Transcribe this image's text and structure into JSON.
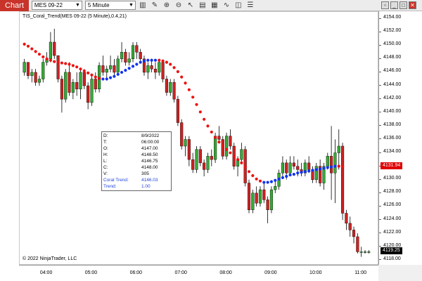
{
  "toolbar": {
    "chart_tab": "Chart",
    "instrument": "MES 09-22",
    "interval": "5 Minute",
    "icons": [
      "bars-type-icon",
      "draw-tool-icon",
      "zoom-in-icon",
      "zoom-out-icon",
      "pointer-icon",
      "data-box-icon",
      "properties-icon",
      "indicators-icon",
      "strategies-icon",
      "templates-icon"
    ],
    "window_buttons": [
      "restore",
      "minimize",
      "maximize",
      "close"
    ]
  },
  "chart_title": "TIS_Coral_Trend(MES 09-22 (5 Minute),0.4,21)",
  "copyright": "© 2022 NinjaTrader, LLC",
  "info_box": {
    "rows": [
      {
        "label": "D:",
        "value": "8/9/2022"
      },
      {
        "label": "T:",
        "value": "06:00:00"
      },
      {
        "label": "O:",
        "value": "4147.00"
      },
      {
        "label": "H:",
        "value": "4148.50"
      },
      {
        "label": "L:",
        "value": "4146.75"
      },
      {
        "label": "C:",
        "value": "4148.00"
      },
      {
        "label": "V:",
        "value": "305"
      },
      {
        "label": "Coral Trend:",
        "value": "4146.03"
      },
      {
        "label": "Trend:",
        "value": "1.00"
      }
    ]
  },
  "price_labels": {
    "coral": {
      "text": "4131.94",
      "value": 4131.94,
      "color": "#e00000"
    },
    "last": {
      "text": "4119.25",
      "value": 4119.25,
      "color": "#000000"
    }
  },
  "colors": {
    "up": "#33aa33",
    "down": "#cc2222",
    "coral_up": "#1133ee",
    "coral_down": "#ee1111"
  },
  "chart_data": {
    "type": "candlestick",
    "title": "TIS_Coral_Trend(MES 09-22 (5 Minute),0.4,21)",
    "y_ticks": [
      4118,
      4120,
      4122,
      4124,
      4126,
      4128,
      4130,
      4132,
      4134,
      4136,
      4138,
      4140,
      4142,
      4144,
      4146,
      4148,
      4150,
      4152,
      4154
    ],
    "y_tick_labels": [
      "4118.00",
      "4120.00",
      "4122.00",
      "4124.00",
      "4126.00",
      "4128.00",
      "4130.00",
      "4132.00",
      "4134.00",
      "4136.00",
      "4138.00",
      "4140.00",
      "4142.00",
      "4144.00",
      "4146.00",
      "4148.00",
      "4150.00",
      "4152.00",
      "4154.00"
    ],
    "ylim": [
      4117.2,
      4155.0
    ],
    "x_labels": [
      "04:00",
      "05:00",
      "06:00",
      "07:00",
      "08:00",
      "09:00",
      "10:00",
      "11:00"
    ],
    "x_label_bar_index": [
      6,
      18,
      30,
      42,
      54,
      66,
      78,
      90
    ],
    "bar_count": 93,
    "candles": [
      [
        4146.0,
        4148.0,
        4145.5,
        4147.5
      ],
      [
        4147.5,
        4147.5,
        4145.0,
        4145.5
      ],
      [
        4145.5,
        4146.5,
        4144.5,
        4146.0
      ],
      [
        4146.0,
        4146.5,
        4144.0,
        4144.5
      ],
      [
        4144.5,
        4145.5,
        4144.0,
        4145.0
      ],
      [
        4145.0,
        4148.0,
        4144.5,
        4147.5
      ],
      [
        4147.5,
        4149.0,
        4147.0,
        4148.0
      ],
      [
        4148.0,
        4152.0,
        4147.5,
        4150.5
      ],
      [
        4150.5,
        4152.5,
        4148.0,
        4148.5
      ],
      [
        4148.5,
        4148.5,
        4144.5,
        4145.0
      ],
      [
        4145.0,
        4145.5,
        4140.0,
        4142.0
      ],
      [
        4142.0,
        4146.5,
        4141.5,
        4146.0
      ],
      [
        4146.0,
        4147.5,
        4142.5,
        4143.0
      ],
      [
        4143.0,
        4145.0,
        4142.0,
        4144.5
      ],
      [
        4144.5,
        4146.0,
        4142.5,
        4143.5
      ],
      [
        4143.5,
        4146.5,
        4142.0,
        4146.0
      ],
      [
        4146.0,
        4146.5,
        4143.5,
        4144.0
      ],
      [
        4144.0,
        4144.5,
        4140.5,
        4141.5
      ],
      [
        4141.5,
        4145.5,
        4141.0,
        4145.0
      ],
      [
        4145.0,
        4146.0,
        4143.0,
        4143.5
      ],
      [
        4143.5,
        4147.5,
        4143.0,
        4147.0
      ],
      [
        4147.0,
        4148.5,
        4145.5,
        4146.0
      ],
      [
        4146.0,
        4147.0,
        4145.0,
        4146.5
      ],
      [
        4146.5,
        4148.5,
        4146.0,
        4147.0
      ],
      [
        4147.0,
        4148.0,
        4145.5,
        4146.0
      ],
      [
        4146.0,
        4148.5,
        4145.5,
        4148.0
      ],
      [
        4148.0,
        4150.5,
        4147.5,
        4149.0
      ],
      [
        4149.0,
        4149.5,
        4147.0,
        4147.5
      ],
      [
        4147.5,
        4149.0,
        4147.0,
        4148.0
      ],
      [
        4148.0,
        4150.5,
        4147.5,
        4150.0
      ],
      [
        4150.0,
        4150.5,
        4148.0,
        4149.0
      ],
      [
        4149.0,
        4149.5,
        4147.5,
        4148.0
      ],
      [
        4148.0,
        4148.5,
        4145.5,
        4146.0
      ],
      [
        4146.0,
        4147.5,
        4145.0,
        4147.0
      ],
      [
        4147.0,
        4148.0,
        4146.0,
        4146.5
      ],
      [
        4146.5,
        4147.5,
        4145.0,
        4146.0
      ],
      [
        4146.0,
        4148.0,
        4145.5,
        4147.5
      ],
      [
        4147.5,
        4147.5,
        4144.5,
        4145.0
      ],
      [
        4145.0,
        4145.5,
        4142.5,
        4143.0
      ],
      [
        4143.0,
        4145.0,
        4142.5,
        4144.5
      ],
      [
        4144.5,
        4145.0,
        4141.5,
        4142.0
      ],
      [
        4142.0,
        4142.5,
        4138.0,
        4138.5
      ],
      [
        4138.5,
        4139.0,
        4134.5,
        4135.0
      ],
      [
        4135.0,
        4136.5,
        4133.5,
        4136.0
      ],
      [
        4136.0,
        4136.5,
        4132.0,
        4133.0
      ],
      [
        4133.0,
        4134.0,
        4131.0,
        4131.5
      ],
      [
        4131.5,
        4135.0,
        4131.0,
        4134.5
      ],
      [
        4134.5,
        4135.0,
        4132.0,
        4132.5
      ],
      [
        4132.5,
        4133.0,
        4130.5,
        4131.5
      ],
      [
        4131.5,
        4134.0,
        4131.0,
        4133.5
      ],
      [
        4133.5,
        4134.5,
        4132.0,
        4133.0
      ],
      [
        4133.0,
        4137.0,
        4132.5,
        4136.5
      ],
      [
        4136.5,
        4138.0,
        4135.5,
        4136.0
      ],
      [
        4136.0,
        4136.5,
        4133.0,
        4133.5
      ],
      [
        4133.5,
        4137.0,
        4133.0,
        4136.5
      ],
      [
        4136.5,
        4137.5,
        4134.5,
        4135.0
      ],
      [
        4135.0,
        4135.5,
        4131.5,
        4132.0
      ],
      [
        4132.0,
        4133.5,
        4130.5,
        4133.0
      ],
      [
        4133.0,
        4135.5,
        4132.5,
        4134.5
      ],
      [
        4134.5,
        4135.0,
        4129.0,
        4129.5
      ],
      [
        4129.5,
        4130.0,
        4125.0,
        4125.5
      ],
      [
        4125.5,
        4128.5,
        4125.0,
        4128.0
      ],
      [
        4128.0,
        4129.0,
        4126.0,
        4126.5
      ],
      [
        4126.5,
        4129.0,
        4126.0,
        4128.5
      ],
      [
        4128.5,
        4129.5,
        4126.5,
        4127.0
      ],
      [
        4127.0,
        4127.5,
        4123.5,
        4125.5
      ],
      [
        4125.5,
        4129.0,
        4125.0,
        4128.5
      ],
      [
        4128.5,
        4130.0,
        4128.0,
        4129.0
      ],
      [
        4129.0,
        4131.5,
        4128.5,
        4131.0
      ],
      [
        4131.0,
        4133.5,
        4130.5,
        4132.5
      ],
      [
        4132.5,
        4133.0,
        4130.0,
        4131.0
      ],
      [
        4131.0,
        4133.5,
        4130.5,
        4132.5
      ],
      [
        4132.5,
        4133.5,
        4131.5,
        4132.0
      ],
      [
        4132.0,
        4133.0,
        4130.5,
        4131.5
      ],
      [
        4131.5,
        4132.5,
        4130.5,
        4131.0
      ],
      [
        4131.0,
        4133.0,
        4130.5,
        4132.5
      ],
      [
        4132.5,
        4133.5,
        4131.0,
        4131.5
      ],
      [
        4131.5,
        4132.0,
        4129.5,
        4130.0
      ],
      [
        4130.0,
        4132.5,
        4129.5,
        4132.0
      ],
      [
        4132.0,
        4133.0,
        4129.0,
        4129.5
      ],
      [
        4129.5,
        4132.5,
        4128.5,
        4132.0
      ],
      [
        4132.0,
        4134.0,
        4131.5,
        4133.5
      ],
      [
        4133.5,
        4138.0,
        4127.0,
        4131.0
      ],
      [
        4131.0,
        4136.0,
        4126.5,
        4134.0
      ],
      [
        4134.0,
        4137.5,
        4131.5,
        4135.0
      ],
      [
        4135.0,
        4135.5,
        4124.0,
        4125.0
      ],
      [
        4125.0,
        4125.5,
        4122.5,
        4123.5
      ],
      [
        4123.5,
        4124.5,
        4121.5,
        4122.5
      ],
      [
        4122.5,
        4123.0,
        4120.5,
        4121.5
      ],
      [
        4121.5,
        4122.0,
        4119.0,
        4119.25
      ],
      [
        4119.25,
        4120.0,
        4118.5,
        4119.25
      ],
      [
        4119.25,
        4119.5,
        4119.0,
        4119.25
      ],
      [
        4119.25,
        4119.5,
        4119.0,
        4119.25
      ]
    ],
    "coral_trend": [
      4150.2,
      4149.9,
      4149.5,
      4149.1,
      4148.7,
      4148.3,
      4148.0,
      4147.8,
      4147.6,
      4147.5,
      4147.4,
      4147.3,
      4147.2,
      4147.0,
      4146.8,
      4146.5,
      4146.2,
      4145.9,
      4145.6,
      4145.3,
      4145.1,
      4145.0,
      4145.0,
      4145.2,
      4145.4,
      4145.7,
      4146.0,
      4146.3,
      4146.6,
      4146.9,
      4147.2,
      4147.5,
      4147.7,
      4147.8,
      4147.8,
      4147.8,
      4147.8,
      4147.7,
      4147.5,
      4147.2,
      4146.7,
      4146.1,
      4145.3,
      4144.4,
      4143.4,
      4142.3,
      4141.2,
      4140.1,
      4139.0,
      4138.0,
      4137.1,
      4136.3,
      4135.6,
      4135.0,
      4134.5,
      4134.0,
      4133.5,
      4133.0,
      4132.5,
      4131.9,
      4131.2,
      4130.6,
      4130.1,
      4129.8,
      4129.6,
      4129.6,
      4129.7,
      4129.9,
      4130.1,
      4130.3,
      4130.5,
      4130.7,
      4130.8,
      4131.0,
      4131.1,
      4131.2,
      4131.3,
      4131.4,
      4131.5,
      4131.6,
      4131.7,
      4131.8,
      4131.9,
      4132.0,
      4132.0,
      4131.94
    ],
    "coral_trend_direction": [
      -1,
      -1,
      -1,
      -1,
      -1,
      -1,
      -1,
      -1,
      -1,
      -1,
      -1,
      -1,
      -1,
      -1,
      -1,
      -1,
      -1,
      -1,
      -1,
      -1,
      -1,
      1,
      1,
      1,
      1,
      1,
      1,
      1,
      1,
      1,
      1,
      1,
      1,
      1,
      1,
      1,
      -1,
      -1,
      -1,
      -1,
      -1,
      -1,
      -1,
      -1,
      -1,
      -1,
      -1,
      -1,
      -1,
      -1,
      -1,
      -1,
      -1,
      -1,
      -1,
      -1,
      -1,
      -1,
      -1,
      -1,
      -1,
      -1,
      -1,
      -1,
      1,
      1,
      1,
      1,
      1,
      1,
      1,
      1,
      1,
      1,
      1,
      1,
      1,
      1,
      1,
      1,
      1,
      1,
      1,
      1,
      -1,
      -1
    ]
  }
}
